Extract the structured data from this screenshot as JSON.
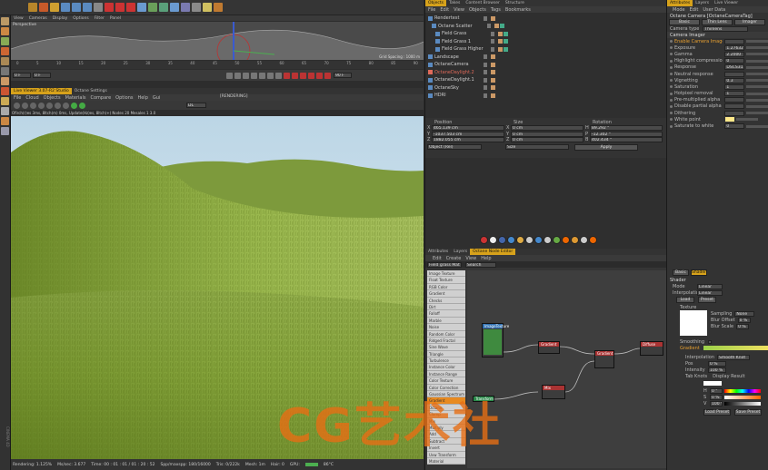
{
  "top_toolbar": {
    "icons": [
      "move-icon",
      "scale-icon",
      "rotate-icon",
      "axis-x-icon",
      "axis-y-icon",
      "axis-z-icon",
      "world-icon",
      "render-region-icon",
      "render-view-icon",
      "render-settings-icon",
      "cube-icon",
      "spline-pen-icon",
      "subdivide-icon",
      "cloner-icon",
      "bend-icon",
      "camera-icon",
      "light-icon",
      "octane-icon"
    ]
  },
  "timeline": {
    "menu": [
      "View",
      "Cameras",
      "Display",
      "Options",
      "Filter",
      "Panel"
    ],
    "viewport_label": "Perspective",
    "grid_label": "Grid Spacing : 1000 m",
    "frame_start": "0 F",
    "frame_end": "90 F",
    "current_frame": "0 F",
    "ruler": [
      "0",
      "5",
      "10",
      "15",
      "20",
      "25",
      "30",
      "35",
      "40",
      "45",
      "50",
      "55",
      "60",
      "65",
      "70",
      "75",
      "80",
      "85",
      "90"
    ]
  },
  "live_viewer": {
    "tabs": [
      "Live Viewer 3.07-R2 Studio",
      "Octane Settings"
    ],
    "menu": [
      "File",
      "Cloud",
      "Objects",
      "Materials",
      "Compare",
      "Options",
      "Help",
      "Gui"
    ],
    "status_center": "[RENDERING]",
    "info_line": "Ofirch(r)es 3ms, 8ltch(m) 0ms, Update(Hz)es, 8ltch(+) Nodes 20 Mesales 1 3.0",
    "channel": "DL",
    "status_bar": {
      "rendering": "Rendering: 1.125%",
      "ms_sec": "Ms/sec: 3.677",
      "time": "Time: 00 : 01 : 01 / 01 : 20 : 52",
      "spp": "Spp/maxspp: 180/16000",
      "tris": "Tris: 0/222k",
      "mesh": "Mesh: 1m",
      "hair": "Hair: 0",
      "gpu": "GPU:",
      "gpu_temp": "86°C"
    }
  },
  "object_manager": {
    "tabs": [
      "Objects",
      "Takes",
      "Content Browser",
      "Structure"
    ],
    "menu": [
      "File",
      "Edit",
      "View",
      "Objects",
      "Tags",
      "Bookmarks"
    ],
    "objects": [
      {
        "name": "Rendertest",
        "color": "#cccccc",
        "indent": 0
      },
      {
        "name": "Octane Scatter",
        "color": "#cccccc",
        "indent": 1
      },
      {
        "name": "Field Grass",
        "color": "#cccccc",
        "indent": 2
      },
      {
        "name": "Field Grass 1",
        "color": "#cccccc",
        "indent": 2
      },
      {
        "name": "Field Grass Higher",
        "color": "#cccccc",
        "indent": 2
      },
      {
        "name": "Landscape",
        "color": "#cccccc",
        "indent": 0
      },
      {
        "name": "OctaneCamera",
        "color": "#cccccc",
        "indent": 0
      },
      {
        "name": "OctaneDaylight.2",
        "color": "#e06a5a",
        "indent": 0
      },
      {
        "name": "OctaneDaylight.1",
        "color": "#cccccc",
        "indent": 0
      },
      {
        "name": "OctaneSky",
        "color": "#cccccc",
        "indent": 0
      },
      {
        "name": "HDRI",
        "color": "#cccccc",
        "indent": 0
      }
    ]
  },
  "coordinates": {
    "headers": [
      "Position",
      "Size",
      "Rotation"
    ],
    "rows": [
      [
        "X",
        "465.139 cm",
        "X",
        "0 cm",
        "H",
        "89.292 °"
      ],
      [
        "Y",
        "-1037.503 cm",
        "Y",
        "0 cm",
        "P",
        "-12.302 °"
      ],
      [
        "Z",
        "1882.055 cm",
        "Z",
        "0 cm",
        "B",
        "402.434 °"
      ]
    ],
    "mode_left": "Object (Rel)",
    "mode_mid": "Size",
    "apply": "Apply"
  },
  "node_editor": {
    "tabs": [
      "Attributes",
      "Layers",
      "Octane Node Editor"
    ],
    "menu": [
      "Edit",
      "Create",
      "View",
      "Help"
    ],
    "material_field": "Field grass Mat",
    "search": "Search",
    "categories": [
      "Image Texture",
      "Float Texture",
      "RGB Color",
      "Gradient",
      "Checks",
      "Dirt",
      "Falloff",
      "Marble",
      "Noise",
      "Random Color",
      "Ridged Fractal",
      "Sine Wave",
      "Triangle",
      "Turbulence",
      "Instance Color",
      "Instance Range",
      "Color Texture",
      "Color Correction",
      "Gaussian Spectrum",
      "Gradient",
      "Octane",
      "Clamp",
      "Mix",
      "Multiply",
      "Add",
      "Subtract",
      "Invert",
      "Uvw Transform",
      "Material"
    ],
    "selected_category": "Gradient",
    "nodes": [
      {
        "name": "ImageTexture",
        "color": "#2f6fb0"
      },
      {
        "name": "Gradient",
        "color": "#a33"
      },
      {
        "name": "Gradient",
        "color": "#a33"
      },
      {
        "name": "Mix",
        "color": "#a33"
      },
      {
        "name": "Diffuse",
        "color": "#a33"
      },
      {
        "name": "Transform",
        "color": "#2a8a4a"
      }
    ]
  },
  "attributes_top": {
    "tabs": [
      "Attributes",
      "Layers",
      "Live Viewer"
    ],
    "menu": [
      "Mode",
      "Edit",
      "User Data"
    ],
    "title": "Octane Camera [OctaneCameraTag]",
    "subtabs": [
      "Basic",
      "Thin Lens",
      "Imager"
    ],
    "camera_type_label": "Camera type",
    "camera_type": "Thinlens",
    "section": "Camera Imager",
    "params": [
      {
        "label": "Enable Camera Imager",
        "value": "",
        "check": true
      },
      {
        "label": "Exposure",
        "value": "1.27632"
      },
      {
        "label": "Gamma",
        "value": "2.2000"
      },
      {
        "label": "Highlight compression",
        "value": "0"
      },
      {
        "label": "Response",
        "value": "DSCS315N R1.1"
      },
      {
        "label": "Neutral response",
        "value": ""
      },
      {
        "label": "Vignetting",
        "value": "0.3"
      },
      {
        "label": "Saturation",
        "value": "1"
      },
      {
        "label": "Hotpixel removal",
        "value": "1"
      },
      {
        "label": "Pre-multiplied alpha",
        "value": ""
      },
      {
        "label": "Disable partial alpha",
        "value": ""
      },
      {
        "label": "Dithering",
        "value": ""
      },
      {
        "label": "White point",
        "value": ""
      },
      {
        "label": "Saturate to white",
        "value": "0"
      }
    ]
  },
  "attributes_bottom": {
    "tabs": [
      "Basic",
      "Shader"
    ],
    "section": "Shader",
    "rows": [
      {
        "label": "Mode",
        "value": "Linear"
      },
      {
        "label": "Interpolation",
        "value": "Linear"
      }
    ],
    "buttons": [
      "Load",
      "Preset"
    ],
    "texture_label": "Texture",
    "sampling_label": "Sampling",
    "sampling": "None",
    "blur_offset_label": "Blur Offset",
    "blur_offset": "0 %",
    "blur_scale_label": "Blur Scale",
    "blur_scale": "0 %",
    "smoothing_label": "Smoothing",
    "gradient_label": "Gradient",
    "interpolation_label": "Interpolation",
    "interpolation": "Smooth Knot",
    "pos_label": "Pos",
    "pos": "0 %",
    "intensity_label": "Intensity",
    "intensity": "100 %",
    "knot_labels": [
      "Tab Knots",
      "Display Result"
    ],
    "color_rows": [
      "H",
      "S",
      "V"
    ],
    "color_values": [
      "0 °",
      "0 %",
      "100 %"
    ],
    "bottom_buttons": [
      "Load Preset",
      "Save Preset"
    ]
  },
  "watermark": "CG艺术社"
}
